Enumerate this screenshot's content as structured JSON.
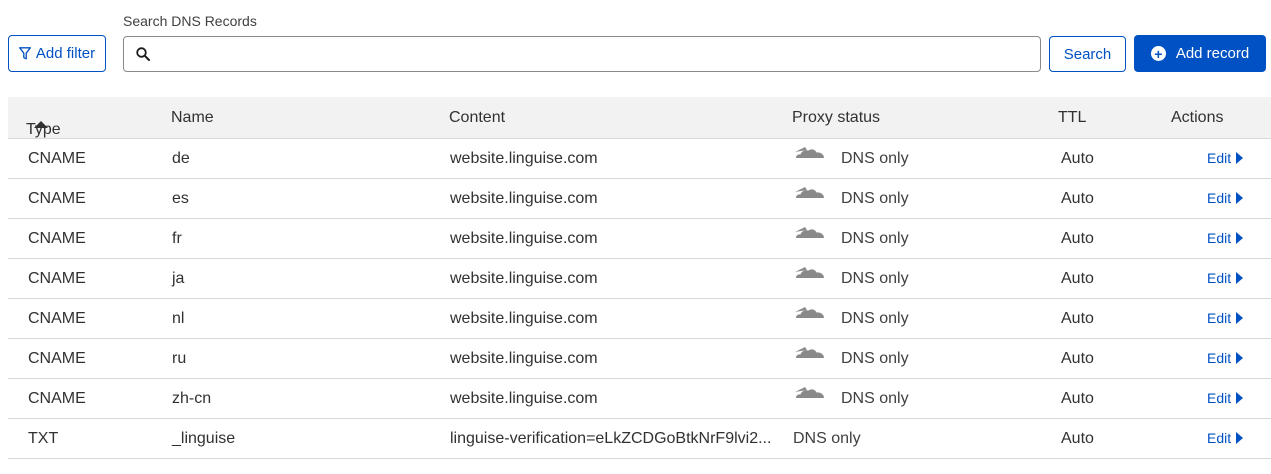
{
  "search": {
    "label": "Search DNS Records",
    "placeholder": "",
    "value": ""
  },
  "toolbar": {
    "add_filter_label": "Add filter",
    "search_button_label": "Search",
    "add_record_label": "Add record"
  },
  "table": {
    "headers": {
      "type": "Type",
      "name": "Name",
      "content": "Content",
      "proxy_status": "Proxy status",
      "ttl": "TTL",
      "actions": "Actions"
    },
    "rows": [
      {
        "type": "CNAME",
        "name": "de",
        "content": "website.linguise.com",
        "proxy": "DNS only",
        "ttl": "Auto",
        "action": "Edit"
      },
      {
        "type": "CNAME",
        "name": "es",
        "content": "website.linguise.com",
        "proxy": "DNS only",
        "ttl": "Auto",
        "action": "Edit"
      },
      {
        "type": "CNAME",
        "name": "fr",
        "content": "website.linguise.com",
        "proxy": "DNS only",
        "ttl": "Auto",
        "action": "Edit"
      },
      {
        "type": "CNAME",
        "name": "ja",
        "content": "website.linguise.com",
        "proxy": "DNS only",
        "ttl": "Auto",
        "action": "Edit"
      },
      {
        "type": "CNAME",
        "name": "nl",
        "content": "website.linguise.com",
        "proxy": "DNS only",
        "ttl": "Auto",
        "action": "Edit"
      },
      {
        "type": "CNAME",
        "name": "ru",
        "content": "website.linguise.com",
        "proxy": "DNS only",
        "ttl": "Auto",
        "action": "Edit"
      },
      {
        "type": "CNAME",
        "name": "zh-cn",
        "content": "website.linguise.com",
        "proxy": "DNS only",
        "ttl": "Auto",
        "action": "Edit"
      },
      {
        "type": "TXT",
        "name": "_linguise",
        "content": "linguise-verification=eLkZCDGoBtkNrF9lvi2...",
        "proxy": "DNS only",
        "ttl": "Auto",
        "action": "Edit"
      }
    ]
  },
  "colors": {
    "accent": "#0051c3",
    "header_bg": "#f2f2f2",
    "cloud_gray": "#8a8a8a"
  },
  "icons": {
    "filter": "filter-icon",
    "search": "search-icon",
    "add": "plus-circle-icon",
    "sort": "sort-asc-icon",
    "proxy": "cloud-dns-only-icon",
    "edit": "caret-right-icon"
  }
}
